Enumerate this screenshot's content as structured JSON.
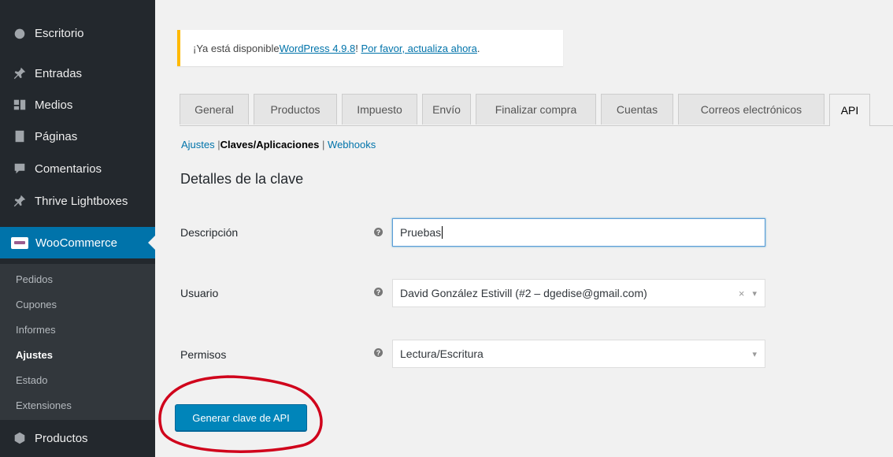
{
  "sidebar": {
    "items": [
      {
        "label": "Escritorio",
        "icon": "dashboard-icon"
      },
      {
        "label": "Entradas",
        "icon": "pin-icon"
      },
      {
        "label": "Medios",
        "icon": "media-icon"
      },
      {
        "label": "Páginas",
        "icon": "pages-icon"
      },
      {
        "label": "Comentarios",
        "icon": "comments-icon"
      },
      {
        "label": "Thrive Lightboxes",
        "icon": "pin-icon"
      },
      {
        "label": "WooCommerce",
        "icon": "woocommerce-icon"
      },
      {
        "label": "Productos",
        "icon": "products-icon"
      }
    ],
    "submenu": [
      "Pedidos",
      "Cupones",
      "Informes",
      "Ajustes",
      "Estado",
      "Extensiones"
    ],
    "current_submenu": "Ajustes"
  },
  "notice": {
    "prefix": "¡Ya está disponible ",
    "link1": "WordPress 4.9.8",
    "middle": "! ",
    "link2": "Por favor, actualiza ahora",
    "suffix": "."
  },
  "tabs": [
    "General",
    "Productos",
    "Impuesto",
    "Envío",
    "Finalizar compra",
    "Cuentas",
    "Correos electrónicos",
    "API"
  ],
  "active_tab": "API",
  "subnav": {
    "ajustes": "Ajustes",
    "sep": "|",
    "claves": "Claves/Aplicaciones",
    "webhooks": "Webhooks"
  },
  "section_title": "Detalles de la clave",
  "form": {
    "descripcion_label": "Descripción",
    "descripcion_value": "Pruebas",
    "usuario_label": "Usuario",
    "usuario_value": "David González Estivill (#2 – dgedise@gmail.com)",
    "permisos_label": "Permisos",
    "permisos_value": "Lectura/Escritura",
    "help_glyph": "?"
  },
  "button": {
    "label": "Generar clave de API"
  },
  "colors": {
    "sidebar": "#23282d",
    "submenu": "#32373c",
    "accent": "#0073aa",
    "button": "#0085ba",
    "notice_border": "#ffb900",
    "annotation": "#d0021b"
  }
}
